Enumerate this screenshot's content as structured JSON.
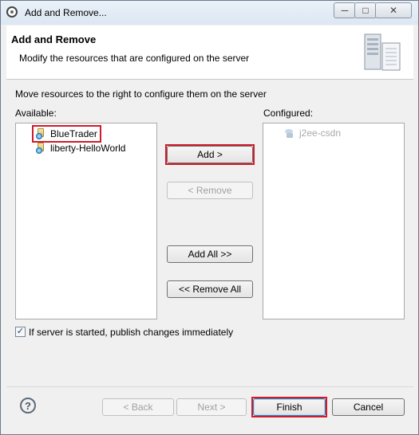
{
  "window": {
    "title": "Add and Remove...",
    "controls": {
      "minimize": "─",
      "maximize": "□",
      "close": "✕"
    }
  },
  "header": {
    "title": "Add and Remove",
    "description": "Modify the resources that are configured on the server",
    "graphic_icon": "server-wizard-graphic"
  },
  "instruction": "Move resources to the right to configure them on the server",
  "available": {
    "label": "Available:",
    "items": [
      {
        "label": "BlueTrader",
        "icon": "web-project-icon",
        "highlighted": true
      },
      {
        "label": "liberty-HelloWorld",
        "icon": "web-project-icon",
        "highlighted": false
      }
    ]
  },
  "configured": {
    "label": "Configured:",
    "items": [
      {
        "label": "j2ee-csdn",
        "icon": "server-project-icon",
        "disabled": true
      }
    ]
  },
  "buttons": {
    "add": "Add >",
    "remove": "< Remove",
    "add_all": "Add All >>",
    "remove_all": "<< Remove All"
  },
  "publish_checkbox": {
    "label": "If server is started, publish changes immediately",
    "checked": true
  },
  "footer": {
    "help_glyph": "?",
    "back": "< Back",
    "next": "Next >",
    "finish": "Finish",
    "cancel": "Cancel"
  },
  "colors": {
    "highlight": "#d11a2a",
    "disabled_text": "#a8a8a8"
  }
}
